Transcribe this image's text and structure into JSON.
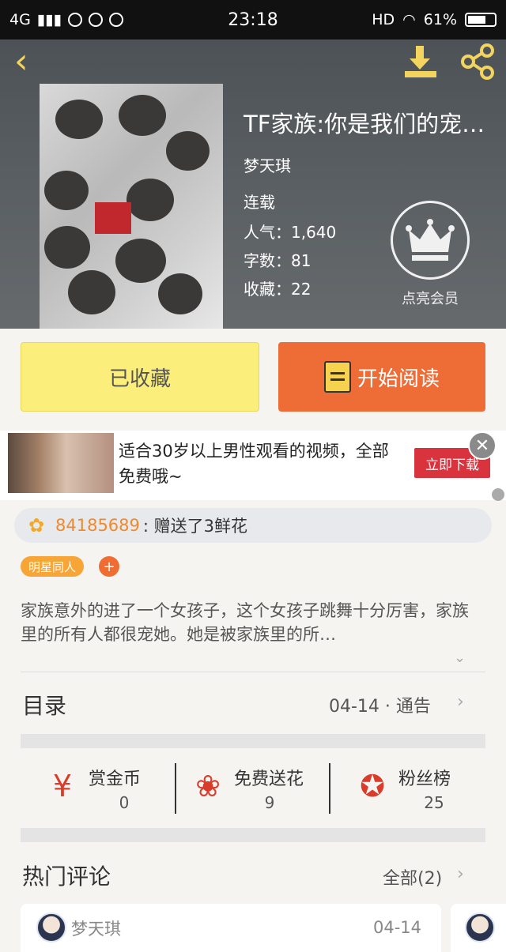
{
  "status_bar": {
    "network": "4G",
    "time": "23:18",
    "hd": "HD",
    "battery": "61%"
  },
  "book": {
    "title": "TF家族:你是我们的宠…",
    "author": "梦天琪",
    "status": "连载",
    "popularity": "人气：1,640",
    "word_count": "字数：81",
    "favorites": "收藏：22"
  },
  "vip": {
    "label": "点亮会员"
  },
  "actions": {
    "collected_label": "已收藏",
    "read_label": "开始阅读"
  },
  "ad": {
    "text": "适合30岁以上男性观看的视频，全部免费哦~",
    "button": "立即下载"
  },
  "gift": {
    "user": "84185689",
    "text": ": 赠送了3鲜花"
  },
  "tags": {
    "items": [
      "明星同人"
    ],
    "add": "+"
  },
  "description": "家族意外的进了一个女孩子，这个女孩子跳舞十分厉害，家族里的所有人都很宠她。她是被家族里的所…",
  "catalog": {
    "title": "目录",
    "meta": "04-14 · 通告"
  },
  "stats": [
    {
      "label": "赏金币",
      "value": "0",
      "icon": "reward-coin-icon"
    },
    {
      "label": "免费送花",
      "value": "9",
      "icon": "flower-icon"
    },
    {
      "label": "粉丝榜",
      "value": "25",
      "icon": "medal-icon"
    }
  ],
  "comments": {
    "title": "热门评论",
    "all": "全部(2)",
    "items": [
      {
        "user": "梦天琪",
        "date": "04-14"
      }
    ]
  },
  "colors": {
    "accent_orange": "#ee6c36",
    "collected_yellow": "#fbee7a",
    "gift_user": "#ee8a2e",
    "stat_red": "#d93c2a"
  }
}
